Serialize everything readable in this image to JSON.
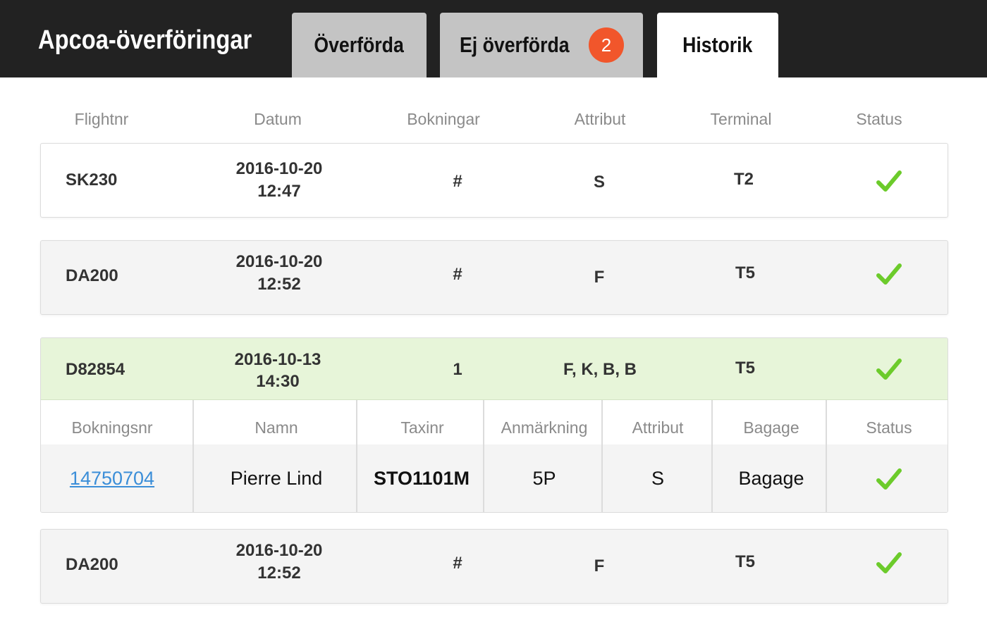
{
  "app": {
    "title": "Apcoa-överföringar"
  },
  "tabs": [
    {
      "label": "Överförda"
    },
    {
      "label": "Ej överförda",
      "badge": "2"
    },
    {
      "label": "Historik",
      "active": true
    }
  ],
  "table": {
    "headers": [
      "Flightnr",
      "Datum",
      "Bokningar",
      "Attribut",
      "Terminal",
      "Status"
    ],
    "rows": [
      {
        "flight": "SK230",
        "date": "2016-10-20",
        "time": "12:47",
        "bookings": "#",
        "attributes": "S",
        "terminal": "T2",
        "status": "ok"
      },
      {
        "flight": "DA200",
        "date": "2016-10-20",
        "time": "12:52",
        "bookings": "#",
        "attributes": "F",
        "terminal": "T5",
        "status": "ok"
      },
      {
        "flight": "D82854",
        "date": "2016-10-13",
        "time": "14:30",
        "bookings": "1",
        "attributes": "F, K, B, B",
        "terminal": "T5",
        "status": "ok",
        "details": {
          "headers": [
            "Bokningsnr",
            "Namn",
            "Taxinr",
            "Anmärkning",
            "Attribut",
            "Bagage",
            "Status"
          ],
          "rows": [
            {
              "booking_no": "14750704",
              "name": "Pierre Lind",
              "taxi_no": "STO1101M",
              "remark": "5P",
              "attribute": "S",
              "baggage": "Bagage",
              "status": "ok"
            }
          ]
        }
      },
      {
        "flight": "DA200",
        "date": "2016-10-20",
        "time": "12:52",
        "bookings": "#",
        "attributes": "F",
        "terminal": "T5",
        "status": "ok"
      }
    ]
  },
  "colors": {
    "topbar": "#222222",
    "badge": "#f1562b",
    "check": "#6ccb2b",
    "expanded_row": "#e7f5d9",
    "link": "#3b8ed8"
  },
  "icons": {
    "status_ok": "check-icon"
  }
}
